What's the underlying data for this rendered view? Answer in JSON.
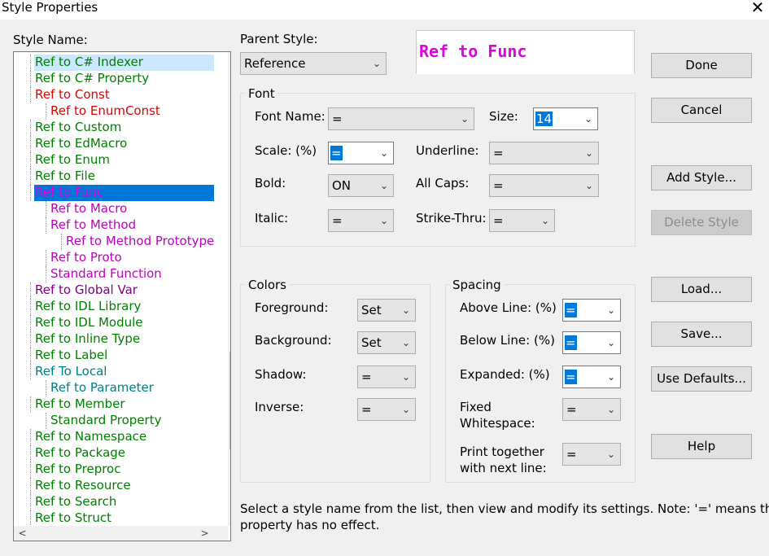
{
  "window": {
    "title": "Style Properties",
    "close_glyph": "✕"
  },
  "style_list": {
    "label": "Style Name:",
    "items": [
      {
        "text": "Ref to C# Indexer",
        "indent": 0,
        "color": "#008000",
        "state": "highlight"
      },
      {
        "text": "Ref to C# Property",
        "indent": 0,
        "color": "#008000"
      },
      {
        "text": "Ref to Const",
        "indent": 0,
        "color": "#e00000"
      },
      {
        "text": "Ref to EnumConst",
        "indent": 1,
        "color": "#e00000"
      },
      {
        "text": "Ref to Custom",
        "indent": 0,
        "color": "#008000"
      },
      {
        "text": "Ref to EdMacro",
        "indent": 0,
        "color": "#008000"
      },
      {
        "text": "Ref to Enum",
        "indent": 0,
        "color": "#008000"
      },
      {
        "text": "Ref to File",
        "indent": 0,
        "color": "#008000"
      },
      {
        "text": "Ref to Func",
        "indent": 0,
        "color": "#e000e0",
        "state": "selected"
      },
      {
        "text": "Ref to Macro",
        "indent": 1,
        "color": "#c000c0"
      },
      {
        "text": "Ref to Method",
        "indent": 1,
        "color": "#c000c0"
      },
      {
        "text": "Ref to Method Prototype",
        "indent": 2,
        "color": "#c000c0"
      },
      {
        "text": "Ref to Proto",
        "indent": 1,
        "color": "#c000c0"
      },
      {
        "text": "Standard Function",
        "indent": 1,
        "color": "#c000c0"
      },
      {
        "text": "Ref to Global Var",
        "indent": 0,
        "color": "#800080"
      },
      {
        "text": "Ref to IDL Library",
        "indent": 0,
        "color": "#008000"
      },
      {
        "text": "Ref to IDL Module",
        "indent": 0,
        "color": "#008000"
      },
      {
        "text": "Ref to Inline Type",
        "indent": 0,
        "color": "#008000"
      },
      {
        "text": "Ref to Label",
        "indent": 0,
        "color": "#008000"
      },
      {
        "text": "Ref To Local",
        "indent": 0,
        "color": "#008080"
      },
      {
        "text": "Ref to Parameter",
        "indent": 1,
        "color": "#008080"
      },
      {
        "text": "Ref to Member",
        "indent": 0,
        "color": "#008000"
      },
      {
        "text": "Standard Property",
        "indent": 1,
        "color": "#008000"
      },
      {
        "text": "Ref to Namespace",
        "indent": 0,
        "color": "#008000"
      },
      {
        "text": "Ref to Package",
        "indent": 0,
        "color": "#008000"
      },
      {
        "text": "Ref to Preproc",
        "indent": 0,
        "color": "#008000"
      },
      {
        "text": "Ref to Resource",
        "indent": 0,
        "color": "#008000"
      },
      {
        "text": "Ref to Search",
        "indent": 0,
        "color": "#008000"
      },
      {
        "text": "Ref to Struct",
        "indent": 0,
        "color": "#008000"
      }
    ],
    "scroll_up_glyph": "∧",
    "scroll_down_glyph": "∨",
    "scroll_left_glyph": "<",
    "scroll_right_glyph": ">"
  },
  "parent_style": {
    "label": "Parent Style:",
    "value": "Reference"
  },
  "preview": {
    "text": "Ref to Func",
    "color": "#e000e0"
  },
  "font": {
    "group_label": "Font",
    "font_name": {
      "label": "Font Name:",
      "value": "="
    },
    "size": {
      "label": "Size:",
      "value": "14"
    },
    "scale": {
      "label": "Scale: (%)",
      "value": "="
    },
    "underline": {
      "label": "Underline:",
      "value": "="
    },
    "bold": {
      "label": "Bold:",
      "value": "ON"
    },
    "all_caps": {
      "label": "All Caps:",
      "value": "="
    },
    "italic": {
      "label": "Italic:",
      "value": "="
    },
    "strike_thru": {
      "label": "Strike-Thru:",
      "value": "="
    }
  },
  "colors": {
    "group_label": "Colors",
    "foreground": {
      "label": "Foreground:",
      "value": "Set"
    },
    "background": {
      "label": "Background:",
      "value": "Set"
    },
    "shadow": {
      "label": "Shadow:",
      "value": "="
    },
    "inverse": {
      "label": "Inverse:",
      "value": "="
    }
  },
  "spacing": {
    "group_label": "Spacing",
    "above_line": {
      "label": "Above Line: (%)",
      "value": "="
    },
    "below_line": {
      "label": "Below Line: (%)",
      "value": "="
    },
    "expanded": {
      "label": "Expanded: (%)",
      "value": "="
    },
    "fixed_whitespace": {
      "label1": "Fixed",
      "label2": "Whitespace:",
      "value": "="
    },
    "print_together": {
      "label1": "Print together",
      "label2": "with next line:",
      "value": "="
    }
  },
  "buttons": {
    "done": "Done",
    "cancel": "Cancel",
    "add_style": "Add Style...",
    "delete_style": "Delete Style",
    "load": "Load...",
    "save": "Save...",
    "use_defaults": "Use Defaults...",
    "help": "Help"
  },
  "hint": {
    "line1": "Select a style name from the list, then view and modify its settings. Note: '=' means the",
    "line2": "property has no effect."
  },
  "chevron": "⌄"
}
